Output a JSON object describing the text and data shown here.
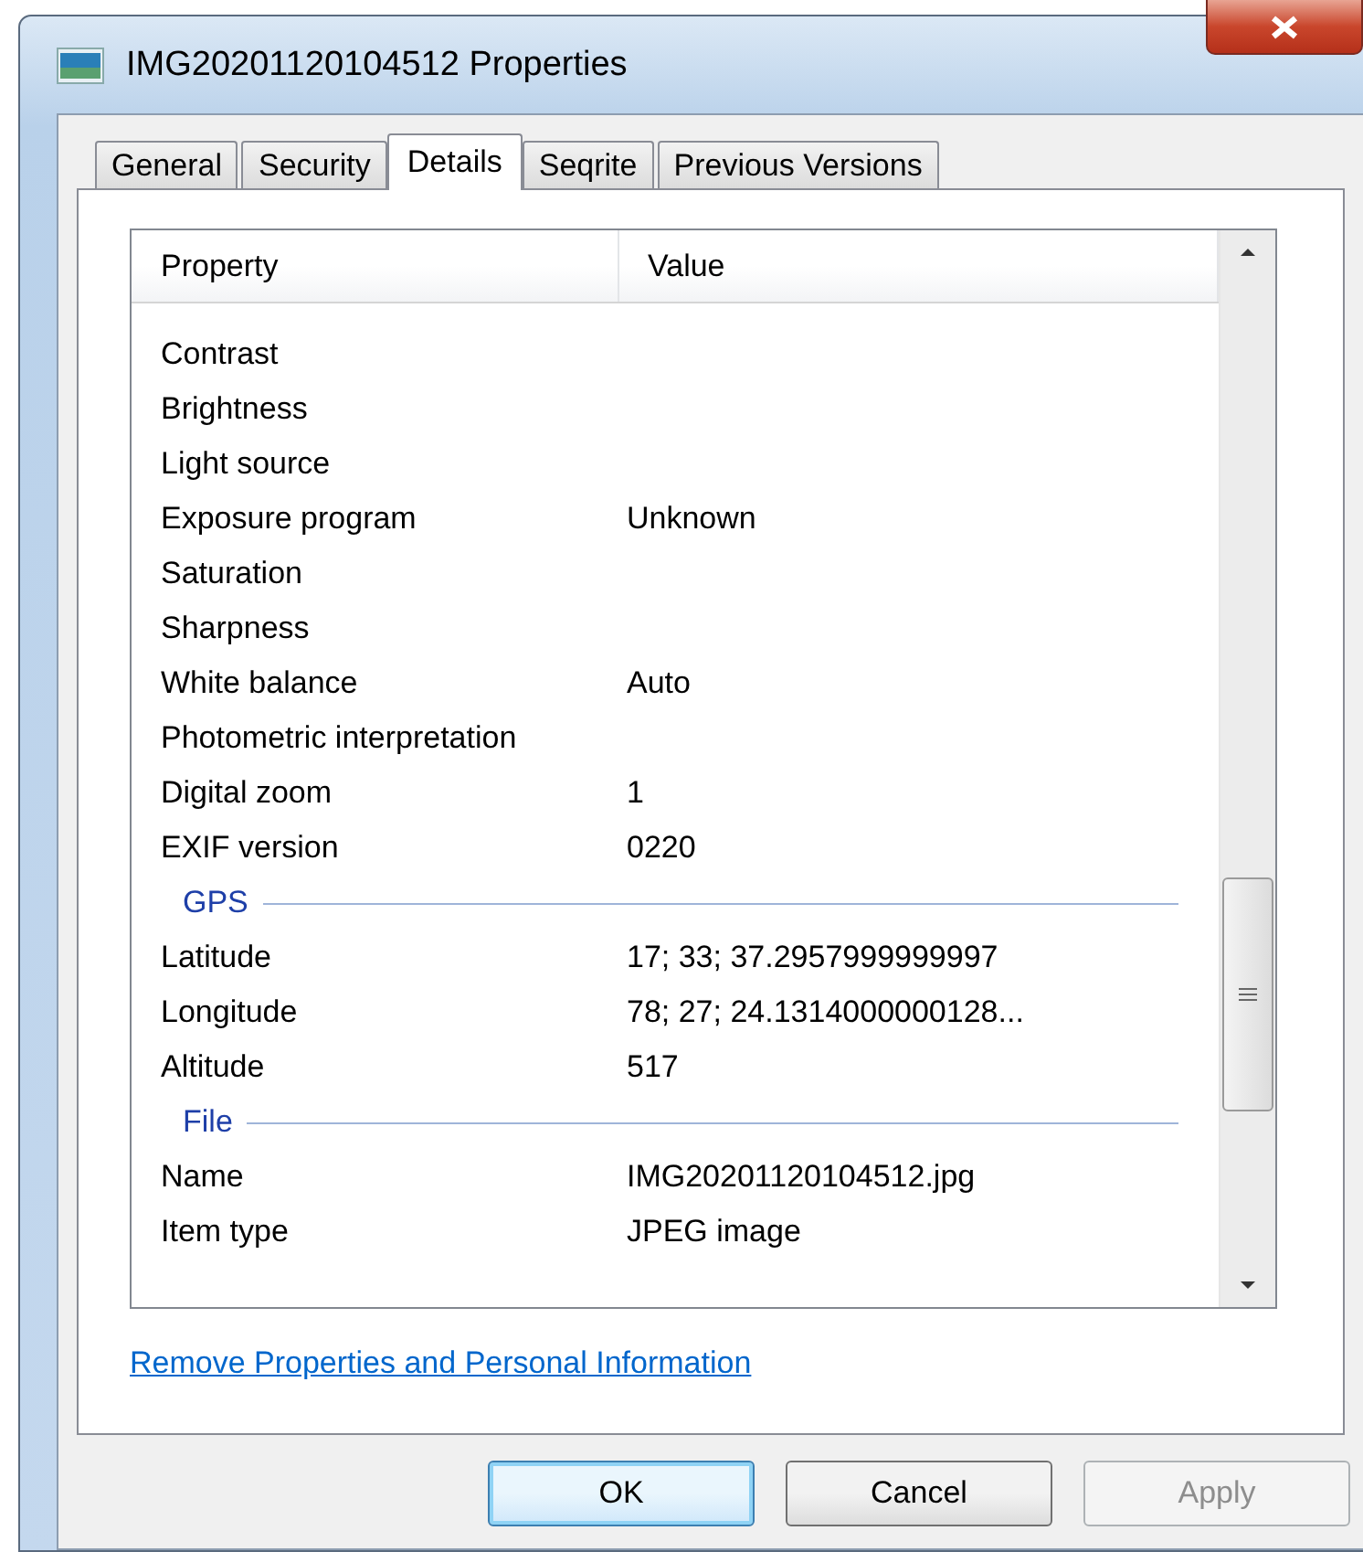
{
  "window": {
    "title": "IMG20201120104512 Properties"
  },
  "tabs": [
    {
      "label": "General",
      "selected": false
    },
    {
      "label": "Security",
      "selected": false
    },
    {
      "label": "Details",
      "selected": true
    },
    {
      "label": "Seqrite",
      "selected": false
    },
    {
      "label": "Previous Versions",
      "selected": false
    }
  ],
  "table": {
    "columns": [
      "Property",
      "Value"
    ],
    "rows": [
      {
        "kind": "property",
        "property": "Contrast",
        "value": ""
      },
      {
        "kind": "property",
        "property": "Brightness",
        "value": ""
      },
      {
        "kind": "property",
        "property": "Light source",
        "value": ""
      },
      {
        "kind": "property",
        "property": "Exposure program",
        "value": "Unknown"
      },
      {
        "kind": "property",
        "property": "Saturation",
        "value": ""
      },
      {
        "kind": "property",
        "property": "Sharpness",
        "value": ""
      },
      {
        "kind": "property",
        "property": "White balance",
        "value": "Auto"
      },
      {
        "kind": "property",
        "property": "Photometric interpretation",
        "value": ""
      },
      {
        "kind": "property",
        "property": "Digital zoom",
        "value": "1"
      },
      {
        "kind": "property",
        "property": "EXIF version",
        "value": "0220"
      },
      {
        "kind": "group",
        "property": "GPS"
      },
      {
        "kind": "property",
        "property": "Latitude",
        "value": "17; 33; 37.2957999999997"
      },
      {
        "kind": "property",
        "property": "Longitude",
        "value": "78; 27; 24.1314000000128..."
      },
      {
        "kind": "property",
        "property": "Altitude",
        "value": "517"
      },
      {
        "kind": "group",
        "property": "File"
      },
      {
        "kind": "property",
        "property": "Name",
        "value": "IMG20201120104512.jpg"
      },
      {
        "kind": "property",
        "property": "Item type",
        "value": "JPEG image"
      }
    ]
  },
  "link": "Remove Properties and Personal Information",
  "buttons": [
    {
      "label": "OK",
      "kind": "default"
    },
    {
      "label": "Cancel",
      "kind": "normal"
    },
    {
      "label": "Apply",
      "kind": "disabled"
    }
  ]
}
